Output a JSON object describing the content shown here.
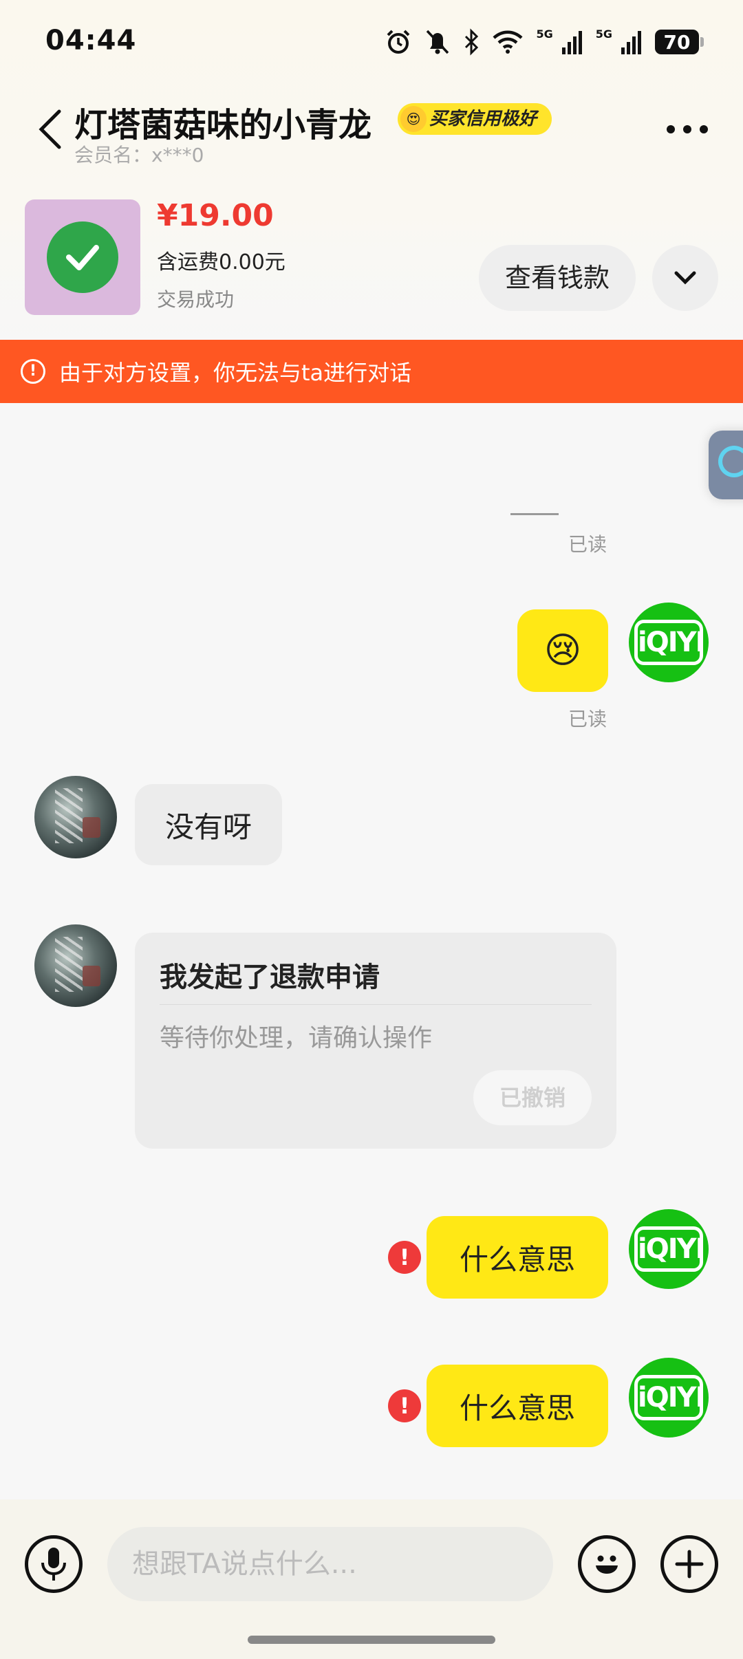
{
  "status_bar": {
    "time": "04:44",
    "network_label": "5G",
    "battery": "70"
  },
  "header": {
    "title": "灯塔菌菇味的小青龙",
    "credit_badge": "买家信用极好",
    "member_name": "会员名：x***0"
  },
  "order": {
    "price": "¥19.00",
    "shipping": "含运费0.00元",
    "status": "交易成功",
    "view_button": "查看钱款"
  },
  "banner": {
    "warning_text": "由于对方设置，你无法与ta进行对话"
  },
  "messages": {
    "read_label_1": "已读",
    "read_label_2": "已读",
    "emoji_message": "😢",
    "avatar_logo": "iQIYI",
    "other_message_1": "没有呀",
    "refund_card": {
      "title": "我发起了退款申请",
      "subtitle": "等待你处理，请确认操作",
      "button": "已撤销"
    },
    "my_message_2": "什么意思",
    "my_message_3": "什么意思",
    "error_mark": "!"
  },
  "input": {
    "placeholder": "想跟TA说点什么..."
  },
  "colors": {
    "accent_yellow": "#ffe815",
    "banner_orange": "#ff5722",
    "price_red": "#ee3a31",
    "avatar_green": "#16c013"
  },
  "icons": {
    "back": "chevron-left-icon",
    "more": "more-dots-icon",
    "expand": "chevron-down-icon",
    "voice": "microphone-icon",
    "emoji": "smiley-icon",
    "add": "plus-icon"
  }
}
